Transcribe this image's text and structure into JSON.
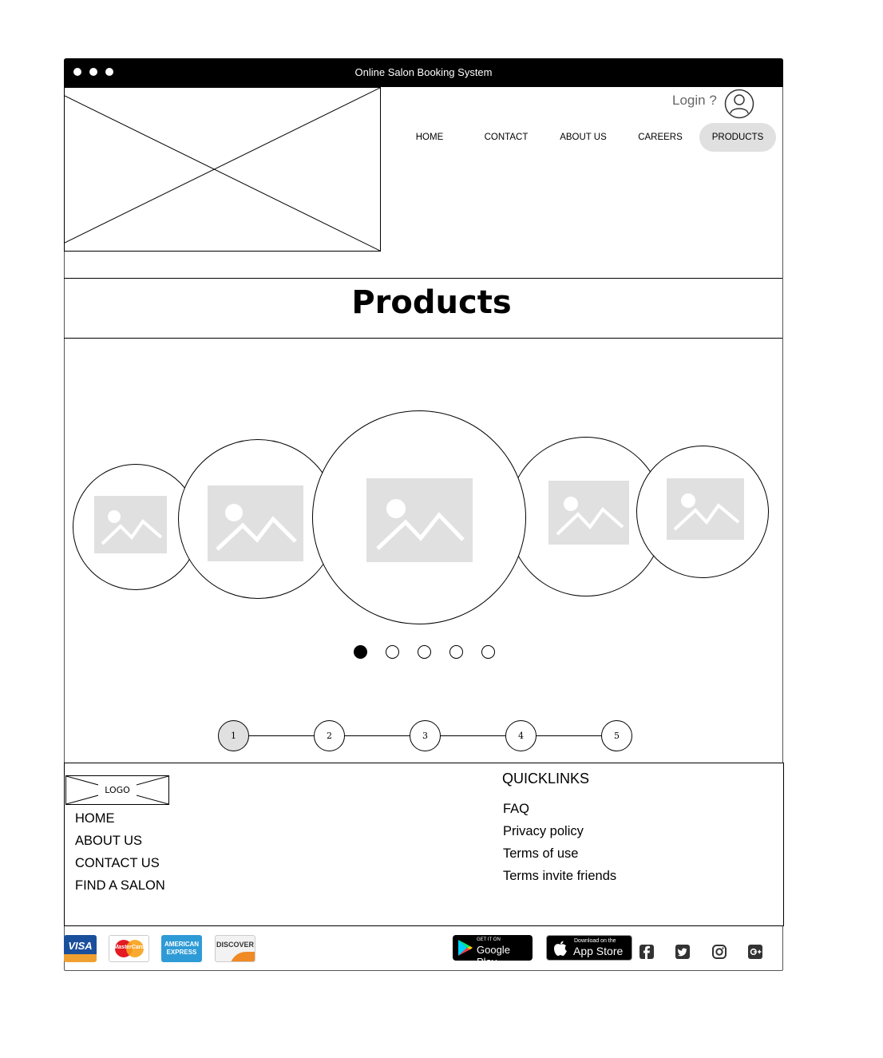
{
  "window": {
    "title": "Online Salon Booking System"
  },
  "header": {
    "login_label": "Login ?",
    "nav": [
      {
        "label": "HOME",
        "active": false
      },
      {
        "label": "CONTACT",
        "active": false
      },
      {
        "label": "ABOUT US",
        "active": false
      },
      {
        "label": "CAREERS",
        "active": false
      },
      {
        "label": "PRODUCTS",
        "active": true
      }
    ]
  },
  "page": {
    "title": "Products"
  },
  "carousel": {
    "items": [
      {
        "icon": "image-placeholder-icon"
      },
      {
        "icon": "image-placeholder-icon"
      },
      {
        "icon": "image-placeholder-icon"
      },
      {
        "icon": "image-placeholder-icon"
      },
      {
        "icon": "image-placeholder-icon"
      }
    ],
    "active_indicator": 1
  },
  "pagination": {
    "pages": [
      "1",
      "2",
      "3",
      "4",
      "5"
    ],
    "current": "1"
  },
  "footer": {
    "logo_label": "LOGO",
    "links": [
      "HOME",
      "ABOUT US",
      "CONTACT US",
      "FIND A SALON"
    ],
    "quicklinks_heading": "QUICKLINKS",
    "quicklinks": [
      "FAQ",
      "Privacy policy",
      "Terms of use",
      "Terms invite friends"
    ],
    "payment_cards": [
      "VISA",
      "MasterCard",
      "AMERICAN EXPRESS",
      "DISCOVER"
    ],
    "stores": [
      {
        "small": "GET IT ON",
        "big": "Google Play"
      },
      {
        "small": "Download on the",
        "big": "App Store"
      }
    ],
    "social": [
      "facebook-icon",
      "twitter-icon",
      "instagram-icon",
      "google-plus-icon"
    ]
  },
  "colors": {
    "active_bg": "#e0e0e0",
    "titlebar_bg": "#000000",
    "placeholder_gray": "#e0e0e0"
  }
}
